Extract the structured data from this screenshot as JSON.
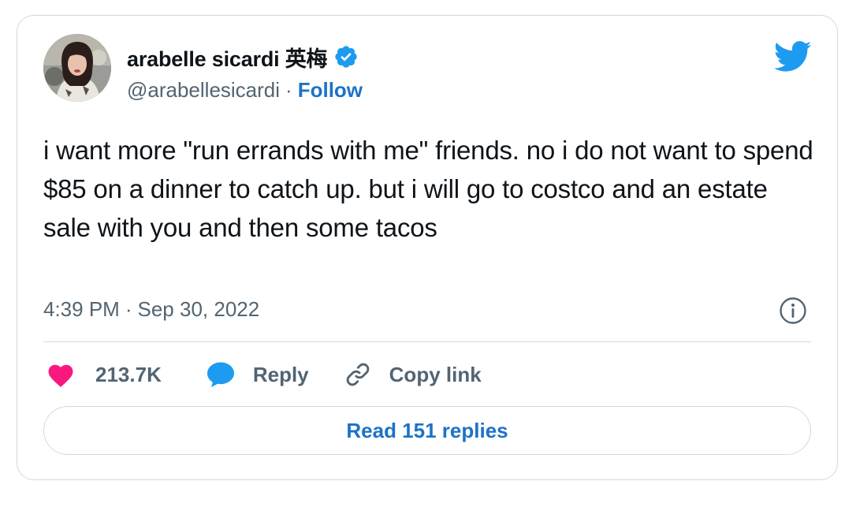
{
  "author": {
    "display_name": "arabelle sicardi 英梅",
    "handle": "@arabellesicardi",
    "separator": "·",
    "follow_label": "Follow",
    "verified_icon": "verified-badge-icon",
    "avatar_icon": "avatar"
  },
  "tweet": {
    "text": "i want more \"run errands with me\" friends. no i do not want to spend $85 on a dinner to catch up. but i will go to costco and an estate sale with you and then some tacos",
    "time": "4:39 PM",
    "separator": "·",
    "date": "Sep 30, 2022"
  },
  "actions": {
    "like_count": "213.7K",
    "reply_label": "Reply",
    "copy_link_label": "Copy link"
  },
  "read_replies_label": "Read 151 replies",
  "icons": {
    "brand": "twitter-bird-icon",
    "info": "info-icon",
    "like": "heart-icon",
    "reply": "speech-bubble-icon",
    "copy": "link-icon"
  },
  "colors": {
    "brand_blue": "#1d9bf0",
    "link_blue": "#1d72c6",
    "like_pink": "#f91880",
    "text_primary": "#0f1419",
    "text_secondary": "#536471",
    "border": "#cfd9de"
  }
}
